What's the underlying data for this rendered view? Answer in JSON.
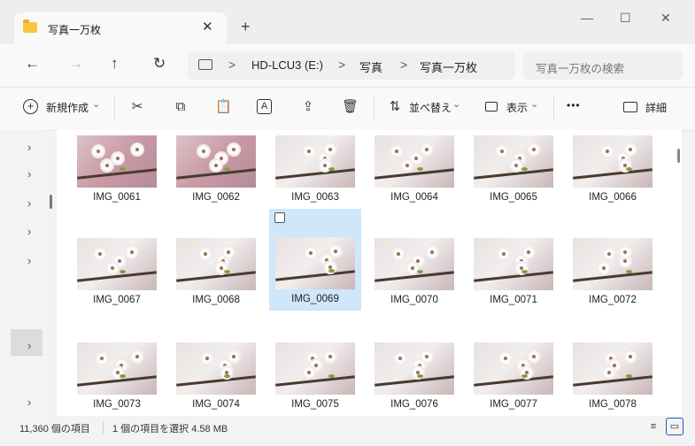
{
  "tab": {
    "title": "写真一万枚",
    "close": "✕",
    "new": "+"
  },
  "window_controls": {
    "minimize": "—",
    "maximize": "☐",
    "close": "✕"
  },
  "nav": {
    "back": "←",
    "forward": "→",
    "up": "↑",
    "refresh": "↻"
  },
  "breadcrumb": {
    "items": [
      "HD-LCU3 (E:)",
      "写真",
      "写真一万枚"
    ],
    "sep": ">"
  },
  "search": {
    "placeholder": "写真一万枚の検索"
  },
  "toolbar": {
    "new_label": "新規作成",
    "sort_label": "並べ替え",
    "view_label": "表示",
    "more_label": "•••",
    "details_label": "詳細",
    "chevron": "⌄"
  },
  "files": [
    "IMG_0061",
    "IMG_0062",
    "IMG_0063",
    "IMG_0064",
    "IMG_0065",
    "IMG_0066",
    "IMG_0067",
    "IMG_0068",
    "IMG_0069",
    "IMG_0070",
    "IMG_0071",
    "IMG_0072",
    "IMG_0073",
    "IMG_0074",
    "IMG_0075",
    "IMG_0076",
    "IMG_0077",
    "IMG_0078"
  ],
  "selected_index": 8,
  "status": {
    "count": "11,360 個の項目",
    "selection": "1 個の項目を選択  4.58 MB"
  },
  "colors": {
    "accent": "#1a5fb4",
    "selection": "#dcebfb"
  }
}
